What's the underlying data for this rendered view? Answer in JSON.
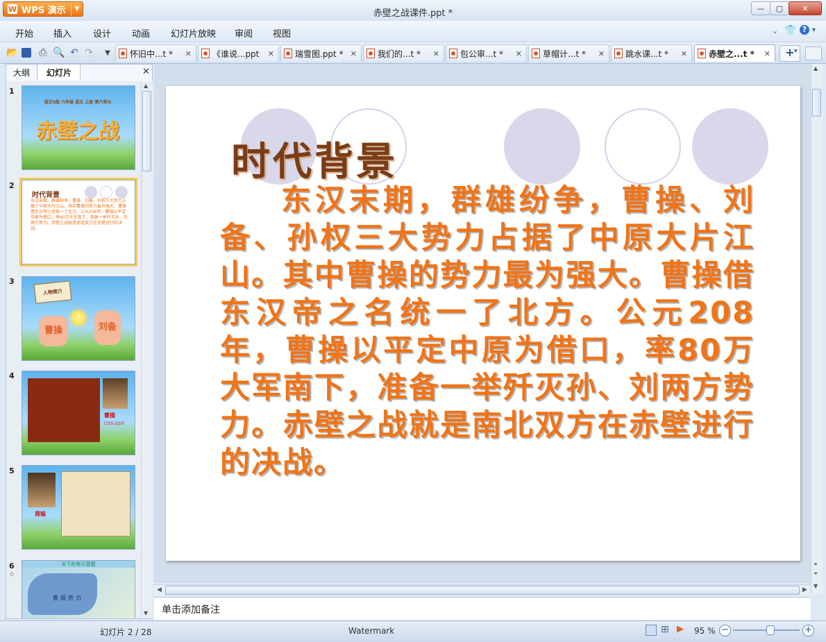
{
  "app": {
    "name": "WPS 演示",
    "logo_letter": "W",
    "window_title": "赤壁之战课件.ppt *"
  },
  "menu": [
    "开始",
    "插入",
    "设计",
    "动画",
    "幻灯片放映",
    "审阅",
    "视图"
  ],
  "doc_tabs": [
    {
      "label": "怀旧中...t *"
    },
    {
      "label": "《谁说...ppt"
    },
    {
      "label": "瑞雪图.ppt *"
    },
    {
      "label": "我们的...t *"
    },
    {
      "label": "包公审...t *"
    },
    {
      "label": "草帽计...t *"
    },
    {
      "label": "跳水课...t *"
    },
    {
      "label": "赤壁之...t *"
    }
  ],
  "left_pane": {
    "tabs": [
      "大纲",
      "幻灯片"
    ],
    "thumbs": [
      {
        "num": "1",
        "header": "语文S版 六年级 语文 上册 第六单元",
        "title": "赤壁之战"
      },
      {
        "num": "2",
        "title": "时代背景",
        "body": "东汉末期，群雄纷争，曹操、刘备、孙权三大势力占据了中原大片江山。其中曹操的势力最为强大。曹操借东汉帝之名统一了北方。公元208年，曹操以平定中原为借口，率80万大军南下，准备一举歼灭孙、刘两方势力。赤壁之战就是南北双方在赤壁进行的决战。"
      },
      {
        "num": "3",
        "scroll": "人物简介",
        "left": "曹操",
        "right": "刘备"
      },
      {
        "num": "4",
        "name": "曹操",
        "years": "（155-220）"
      },
      {
        "num": "5",
        "name": "周瑜"
      },
      {
        "num": "6",
        "title": "天下形势示意图",
        "map_label": "曹操势力"
      }
    ]
  },
  "slide": {
    "title": "时代背景",
    "body_parts": [
      "东汉末期，群雄纷争，曹操、刘备、孙权三大势力占据了中原大片江山。其中曹操的势力最为强大。曹操借东汉帝之名统一了北方。公元",
      "208",
      "年，曹操以平定中原为借口，率",
      "80",
      "万大军南下，准备一举歼灭孙、刘两方势力。赤壁之战就是南北双方在赤壁进行的决战。"
    ]
  },
  "notes_placeholder": "单击添加备注",
  "status": {
    "slide_pos": "幻灯片 2 / 28",
    "watermark": "Watermark",
    "zoom": "95 %",
    "zoom_fraction": 0.55
  },
  "colors": {
    "title": "#7a3c16",
    "body": "#f07418",
    "accent": "#e8741a"
  }
}
